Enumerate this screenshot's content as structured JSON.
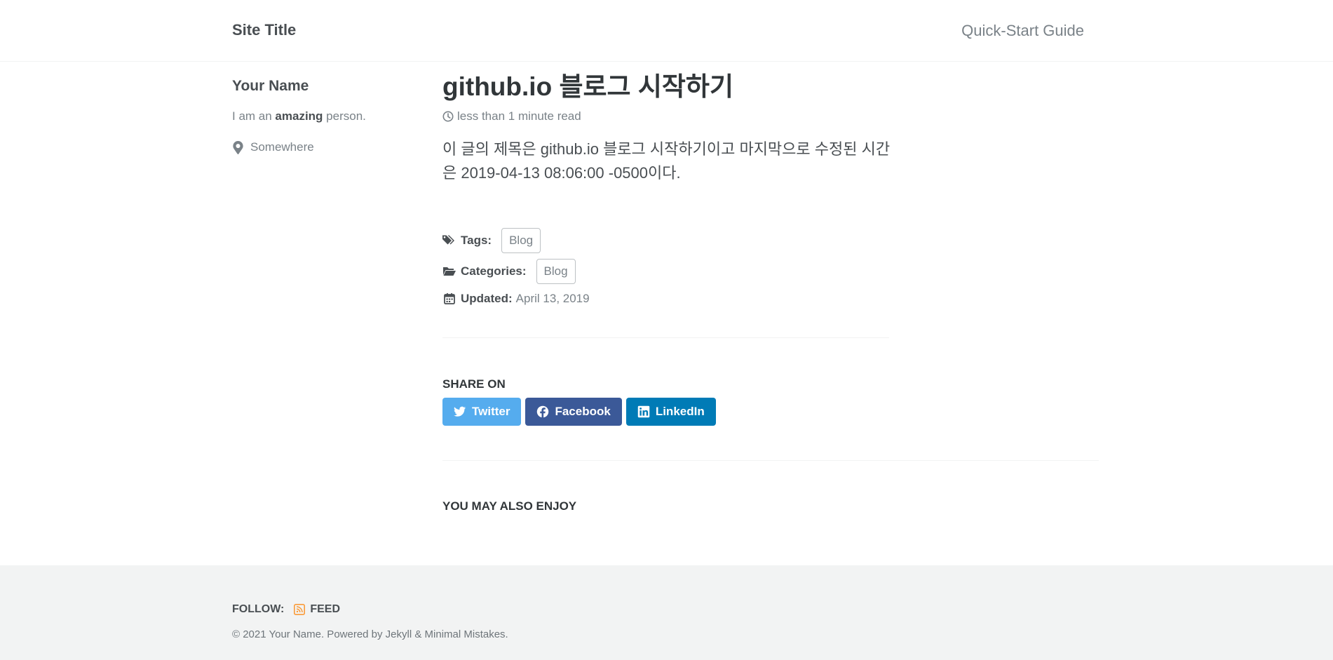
{
  "masthead": {
    "site_title": "Site Title",
    "nav_link": "Quick-Start Guide"
  },
  "sidebar": {
    "author_name": "Your Name",
    "bio_prefix": "I am an ",
    "bio_emphasis": "amazing",
    "bio_suffix": " person.",
    "location": "Somewhere",
    "location_icon": "map-marker-icon"
  },
  "post": {
    "title": "github.io 블로그 시작하기",
    "read_time": "less than 1 minute read",
    "body": "이 글의 제목은 github.io 블로그 시작하기이고 마지막으로 수정된 시간은 2019-04-13 08:06:00 -0500이다.",
    "tags_label": "Tags:",
    "tags": [
      "Blog"
    ],
    "categories_label": "Categories:",
    "categories": [
      "Blog"
    ],
    "updated_label": "Updated:",
    "updated_date": "April 13, 2019"
  },
  "share": {
    "title": "SHARE ON",
    "buttons": [
      {
        "label": "Twitter",
        "color": "#55acee"
      },
      {
        "label": "Facebook",
        "color": "#3b5998"
      },
      {
        "label": "LinkedIn",
        "color": "#007bb6"
      }
    ]
  },
  "related": {
    "title": "YOU MAY ALSO ENJOY"
  },
  "footer": {
    "follow_label": "FOLLOW:",
    "feed_label": "FEED",
    "feed_icon_color": "#fa9b39",
    "copyright": "© 2021 Your Name. Powered by Jekyll & Minimal Mistakes."
  },
  "colors": {
    "text": "#494e52",
    "muted": "#7a8288",
    "footer_bg": "#f2f3f3"
  }
}
